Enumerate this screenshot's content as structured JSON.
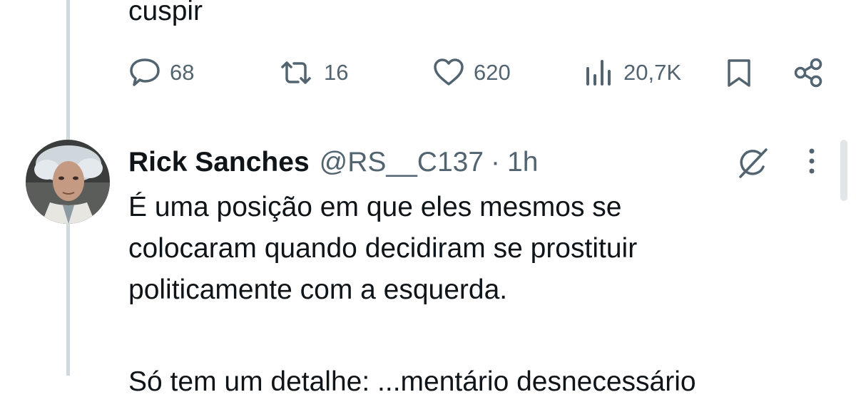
{
  "previous_tweet": {
    "text_tail": "cuspir",
    "actions": {
      "replies": "68",
      "retweets": "16",
      "likes": "620",
      "views": "20,7K"
    }
  },
  "tweet": {
    "display_name": "Rick Sanches",
    "handle": "@RS__C137",
    "separator": "·",
    "time": "1h",
    "lines": [
      "É uma posição em que eles mesmos se",
      "colocaram quando decidiram se prostituir",
      "politicamente com a esquerda."
    ],
    "next_paragraph_partial": "Só tem um detalhe: ...mentário desnecessário"
  },
  "icons": {
    "reply": "reply-icon",
    "retweet": "retweet-icon",
    "like": "heart-icon",
    "views": "views-icon",
    "bookmark": "bookmark-icon",
    "share": "share-icon",
    "grok": "grok-icon",
    "more": "more-icon"
  },
  "colors": {
    "text_primary": "#0f1419",
    "text_secondary": "#536471",
    "thread_line": "#cfd9de",
    "background": "#ffffff"
  }
}
